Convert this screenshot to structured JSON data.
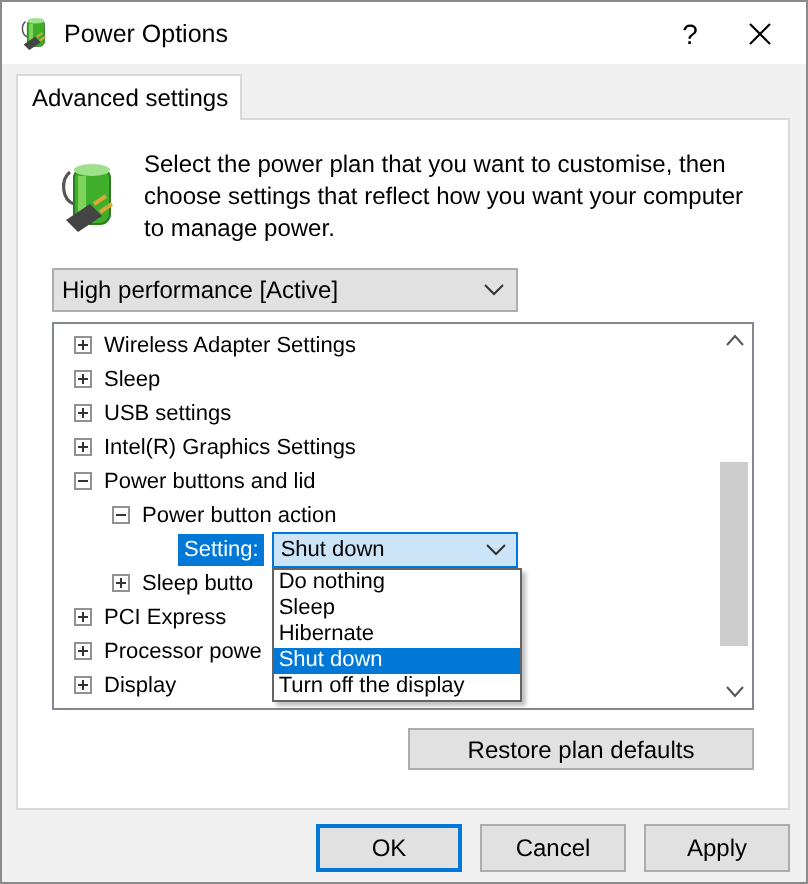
{
  "window": {
    "title": "Power Options",
    "help": "?"
  },
  "tabs": [
    {
      "label": "Advanced settings",
      "selected": true
    }
  ],
  "description": "Select the power plan that you want to customise, then choose settings that reflect how you want your computer to manage power.",
  "plan_select": {
    "value": "High performance [Active]"
  },
  "tree": [
    {
      "kind": "group",
      "label": "Wireless Adapter Settings",
      "expanded": false
    },
    {
      "kind": "group",
      "label": "Sleep",
      "expanded": false
    },
    {
      "kind": "group",
      "label": "USB settings",
      "expanded": false
    },
    {
      "kind": "group",
      "label": "Intel(R) Graphics Settings",
      "expanded": false
    },
    {
      "kind": "group",
      "label": "Power buttons and lid",
      "expanded": true,
      "children": [
        {
          "kind": "group",
          "label": "Power button action",
          "expanded": true,
          "children": [
            {
              "kind": "setting",
              "label": "Setting:",
              "value": "Shut down",
              "options": [
                {
                  "label": "Do nothing",
                  "selected": false
                },
                {
                  "label": "Sleep",
                  "selected": false
                },
                {
                  "label": "Hibernate",
                  "selected": false
                },
                {
                  "label": "Shut down",
                  "selected": true
                },
                {
                  "label": "Turn off the display",
                  "selected": false
                }
              ]
            }
          ]
        },
        {
          "kind": "group",
          "label": "Sleep butto",
          "expanded": false
        }
      ]
    },
    {
      "kind": "group",
      "label": "PCI Express",
      "expanded": false
    },
    {
      "kind": "group",
      "label": "Processor powe",
      "expanded": false
    },
    {
      "kind": "group",
      "label": "Display",
      "expanded": false
    }
  ],
  "restore_button": "Restore plan defaults",
  "buttons": [
    {
      "label": "OK",
      "default": true
    },
    {
      "label": "Cancel",
      "default": false
    },
    {
      "label": "Apply",
      "default": false
    }
  ]
}
